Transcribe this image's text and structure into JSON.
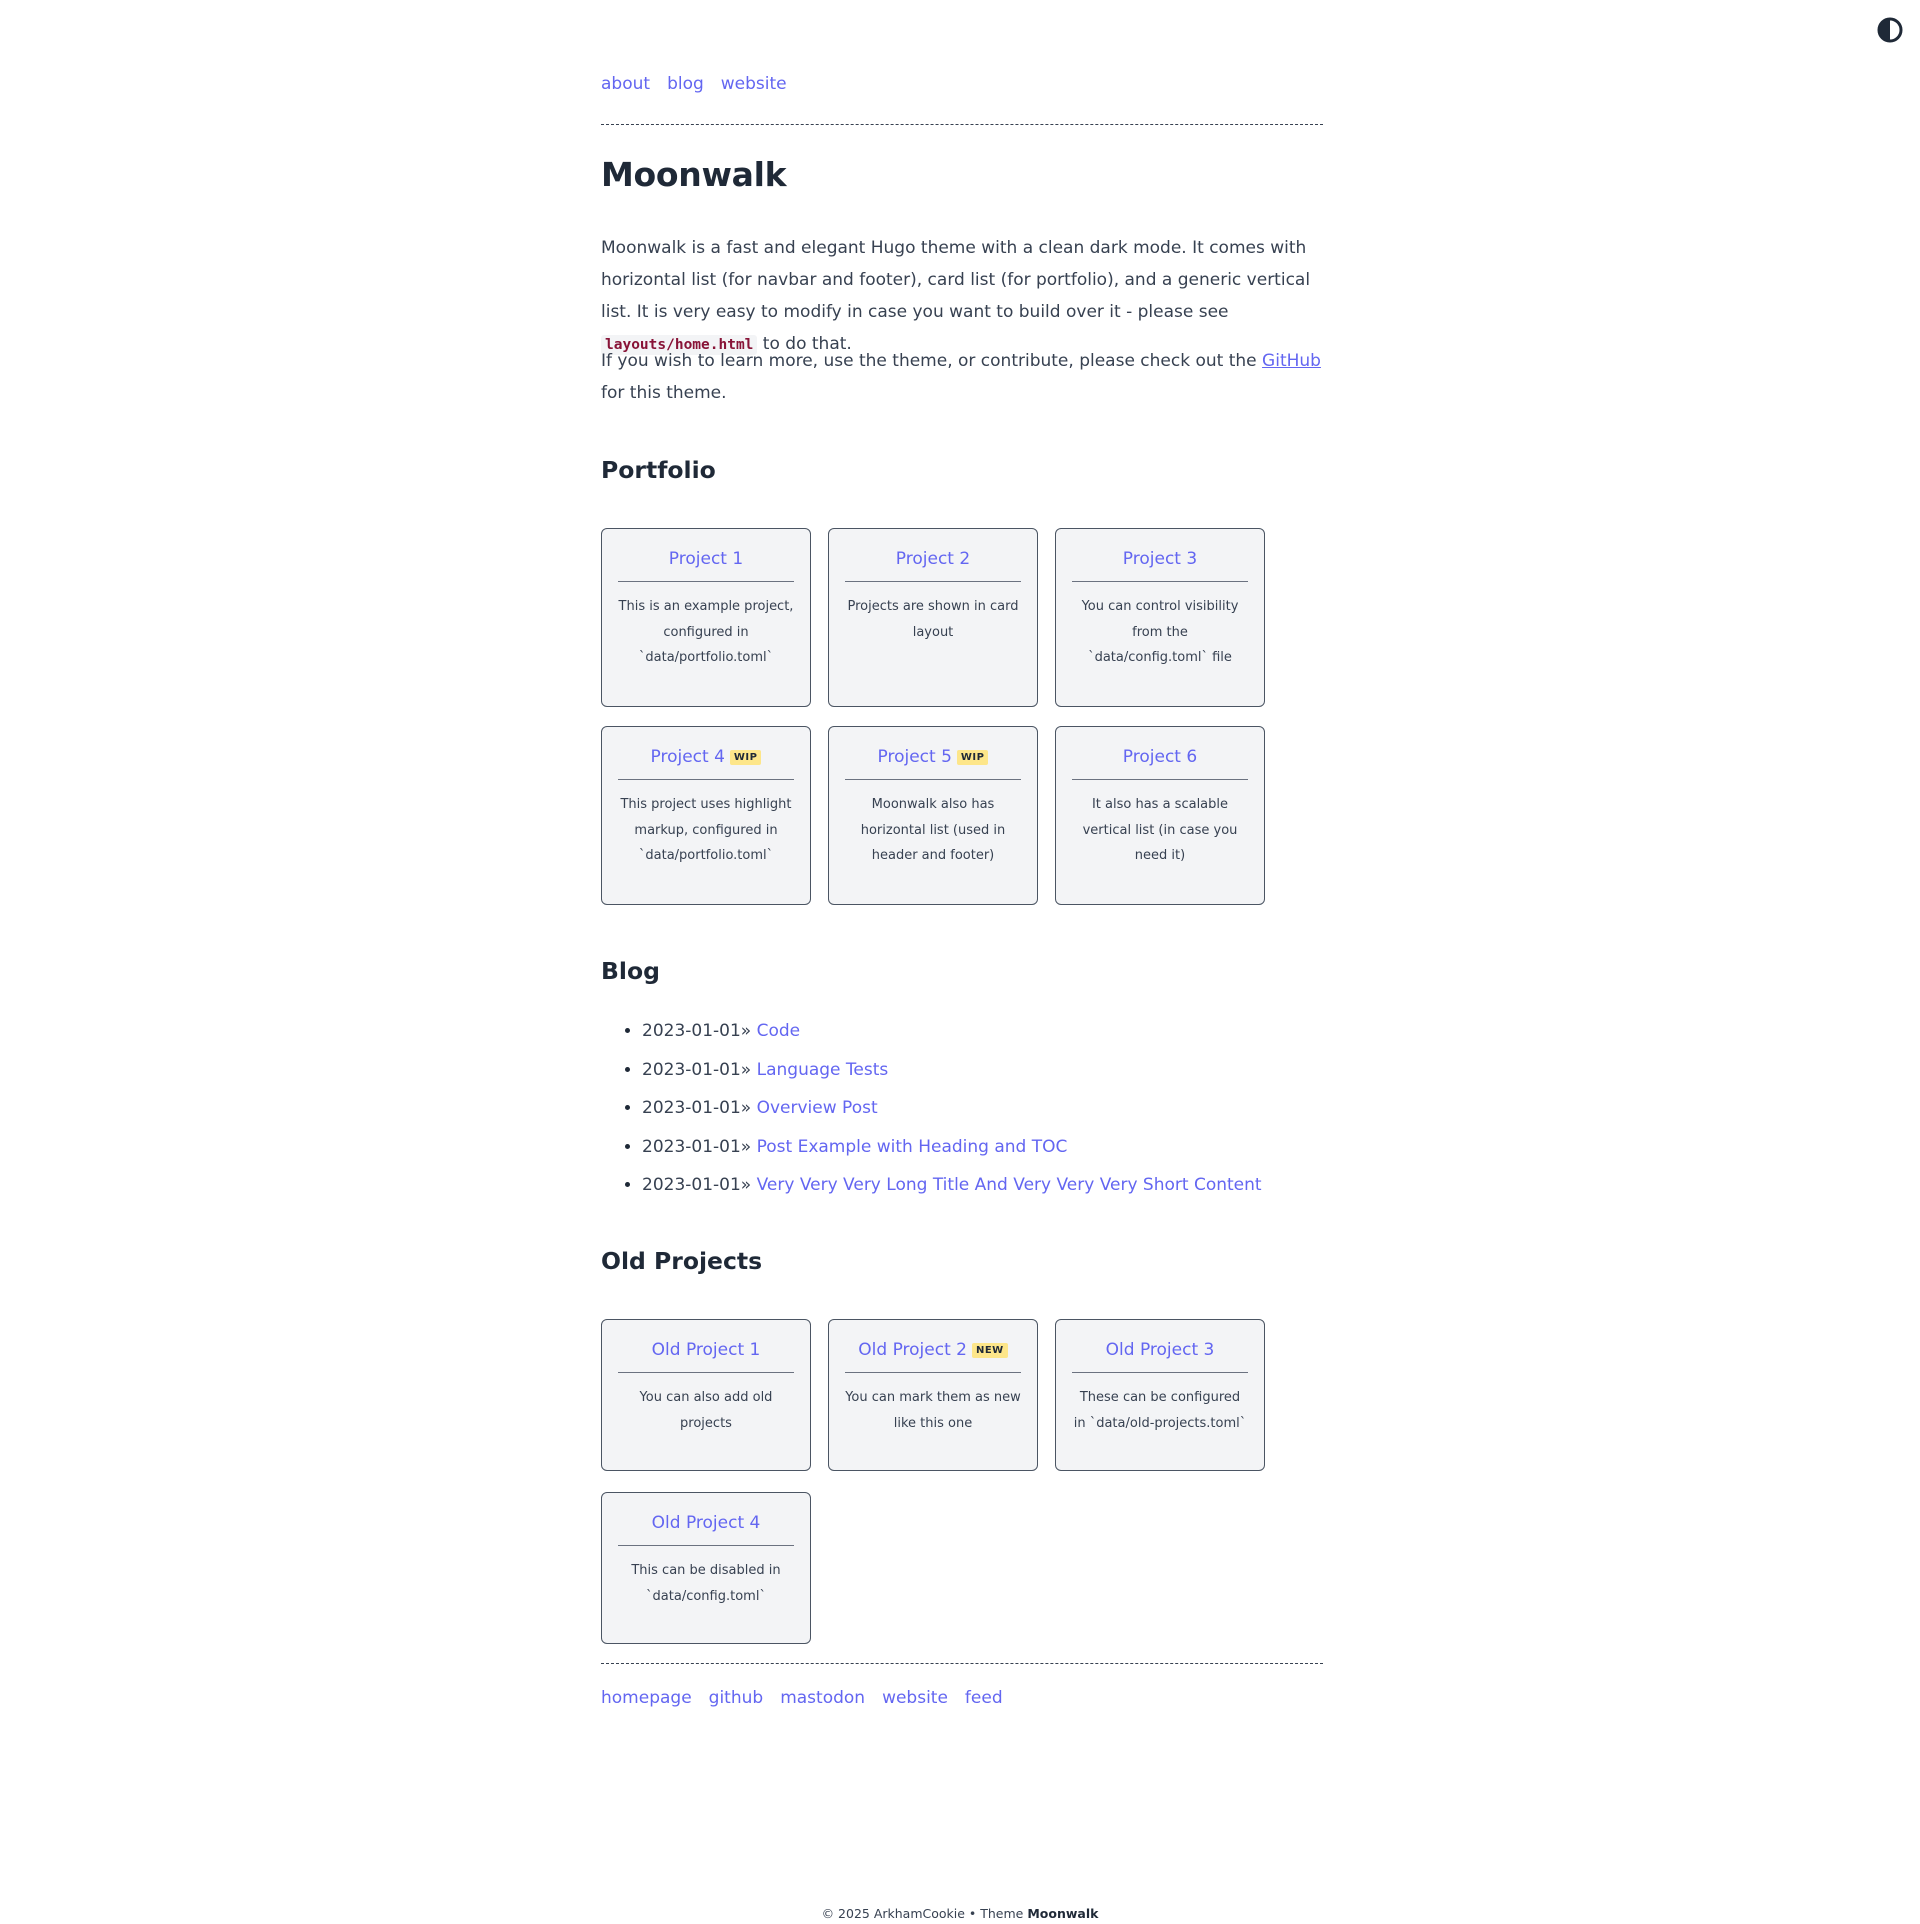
{
  "nav": [
    {
      "label": "about"
    },
    {
      "label": "blog"
    },
    {
      "label": "website"
    }
  ],
  "title": "Moonwalk",
  "intro": {
    "p1_before": "Moonwalk is a fast and elegant Hugo theme with a clean dark mode. It comes with horizontal list (for navbar and footer), card list (for portfolio), and a generic vertical list. It is very easy to modify in case you want to build over it - please see ",
    "p1_code": "layouts/home.html",
    "p1_after": " to do that.",
    "p2_before": "If you wish to learn more, use the theme, or contribute, please check out the ",
    "p2_link": "GitHub",
    "p2_after": " for this theme."
  },
  "portfolio": {
    "heading": "Portfolio",
    "cards": [
      {
        "title": "Project 1",
        "badge": "",
        "desc": "This is an example project, configured in `data/portfolio.toml`"
      },
      {
        "title": "Project 2",
        "badge": "",
        "desc": "Projects are shown in card layout"
      },
      {
        "title": "Project 3",
        "badge": "",
        "desc": "You can control visibility from the `data/config.toml` file"
      },
      {
        "title": "Project 4",
        "badge": "WIP",
        "desc": "This project uses highlight markup, configured in `data/portfolio.toml`"
      },
      {
        "title": "Project 5",
        "badge": "WIP",
        "desc": "Moonwalk also has horizontal list (used in header and footer)"
      },
      {
        "title": "Project 6",
        "badge": "",
        "desc": "It also has a scalable vertical list (in case you need it)"
      }
    ]
  },
  "blog": {
    "heading": "Blog",
    "posts": [
      {
        "date": "2023-01-01»",
        "title": "Code"
      },
      {
        "date": "2023-01-01»",
        "title": "Language Tests"
      },
      {
        "date": "2023-01-01»",
        "title": "Overview Post"
      },
      {
        "date": "2023-01-01»",
        "title": "Post Example with Heading and TOC"
      },
      {
        "date": "2023-01-01»",
        "title": "Very Very Very Long Title And Very Very Very Short Content"
      }
    ]
  },
  "old_projects": {
    "heading": "Old Projects",
    "cards": [
      {
        "title": "Old Project 1",
        "badge": "",
        "desc": "You can also add old projects"
      },
      {
        "title": "Old Project 2",
        "badge": "NEW",
        "desc": "You can mark them as new like this one"
      },
      {
        "title": "Old Project 3",
        "badge": "",
        "desc": "These can be configured in `data/old-projects.toml`"
      },
      {
        "title": "Old Project 4",
        "badge": "",
        "desc": "This can be disabled in `data/config.toml`"
      }
    ]
  },
  "footer_links": [
    {
      "label": "homepage"
    },
    {
      "label": "github"
    },
    {
      "label": "mastodon"
    },
    {
      "label": "website"
    },
    {
      "label": "feed"
    }
  ],
  "copyright": {
    "text": "© 2025 ArkhamCookie • Theme ",
    "theme": "Moonwalk"
  },
  "colors": {
    "link": "#6366f1",
    "text": "#1f2937",
    "card_bg": "#f3f4f6",
    "badge_bg": "#fde68a",
    "code": "#881337"
  },
  "icons": {
    "theme_toggle": "half-circle-contrast-icon"
  }
}
